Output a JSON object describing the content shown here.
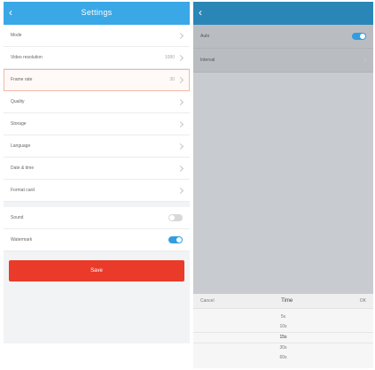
{
  "left": {
    "header": {
      "title": "Settings",
      "back_icon": "chevron-left-icon"
    },
    "rows": [
      {
        "id": "mode",
        "label": "Mode",
        "value": "",
        "control": "chevron"
      },
      {
        "id": "resolution",
        "label": "Video resolution",
        "value": "1080",
        "control": "chevron"
      },
      {
        "id": "frame-rate",
        "label": "Frame rate",
        "value": "30",
        "control": "chevron",
        "highlight": true
      },
      {
        "id": "quality",
        "label": "Quality",
        "value": "",
        "control": "chevron"
      },
      {
        "id": "storage",
        "label": "Storage",
        "value": "",
        "control": "chevron"
      },
      {
        "id": "language",
        "label": "Language",
        "value": "",
        "control": "chevron"
      },
      {
        "id": "date-time",
        "label": "Date & time",
        "value": "",
        "control": "chevron"
      },
      {
        "id": "format",
        "label": "Format card",
        "value": "",
        "control": "chevron"
      }
    ],
    "toggles": [
      {
        "id": "sound",
        "label": "Sound",
        "state": "off"
      },
      {
        "id": "watermark",
        "label": "Watermark",
        "state": "on"
      }
    ],
    "save_button": "Save"
  },
  "right": {
    "rows": [
      {
        "id": "auto",
        "label": "Auto",
        "toggle": "on"
      },
      {
        "id": "interval",
        "label": "Interval",
        "value": ""
      }
    ],
    "hint": "",
    "picker": {
      "cancel": "Cancel",
      "title": "Time",
      "ok": "OK",
      "options": [
        "5s",
        "10s",
        "15s",
        "30s",
        "60s"
      ],
      "selected_index": 2
    }
  },
  "colors": {
    "header_left": "#3aa8e6",
    "header_right": "#2a86b7",
    "save_button": "#ea3a2a",
    "toggle_on": "#2f9de2",
    "highlight_border": "#f4b8a8"
  }
}
